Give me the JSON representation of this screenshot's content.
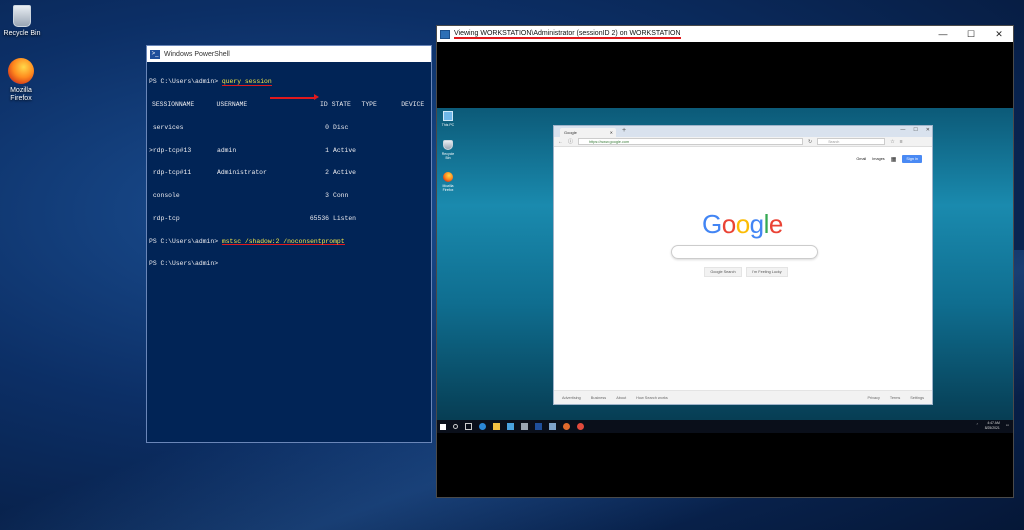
{
  "desktop": {
    "icons": [
      {
        "label": "Recycle Bin",
        "icon": "recycle-bin-icon"
      },
      {
        "label": "Mozilla Firefox",
        "icon": "firefox-icon"
      }
    ]
  },
  "powershell": {
    "title": "Windows PowerShell",
    "prompt": "PS C:\\Users\\admin>",
    "command1": "query session",
    "headers": [
      "SESSIONNAME",
      "USERNAME",
      "ID",
      "STATE",
      "TYPE",
      "DEVICE"
    ],
    "rows": [
      {
        "session": " services",
        "user": "",
        "id": "0",
        "state": "Disc"
      },
      {
        "session": ">rdp-tcp#13",
        "user": "admin",
        "id": "1",
        "state": "Active"
      },
      {
        "session": " rdp-tcp#11",
        "user": "Administrator",
        "id": "2",
        "state": "Active"
      },
      {
        "session": " console",
        "user": "",
        "id": "3",
        "state": "Conn"
      },
      {
        "session": " rdp-tcp",
        "user": "",
        "id": "65536",
        "state": "Listen"
      }
    ],
    "command2": "mstsc /shadow:2 /noconsentprompt"
  },
  "shadow_window": {
    "title": "Viewing WORKSTATION\\Administrator (sessionID 2) on WORKSTATION",
    "controls": {
      "minimize": "—",
      "maximize": "☐",
      "close": "✕"
    },
    "remote_desktop": {
      "icons": [
        "This PC",
        "Recycle Bin",
        "Mozilla Firefox"
      ],
      "browser": {
        "tab_title": "Google",
        "url": "https://www.google.com",
        "search_placeholder": "Search",
        "top_links": [
          "Gmail",
          "Images"
        ],
        "sign_in": "Sign in",
        "logo": [
          "G",
          "o",
          "o",
          "g",
          "l",
          "e"
        ],
        "buttons": [
          "Google Search",
          "I'm Feeling Lucky"
        ],
        "footer_left": [
          "Advertising",
          "Business",
          "About",
          "How Search works"
        ],
        "footer_right": [
          "Privacy",
          "Terms",
          "Settings"
        ]
      },
      "clock": {
        "time": "4:47 AM",
        "date": "8/25/2021"
      }
    }
  },
  "colors": {
    "annotation": "#e0191d",
    "ps_bg": "#012456",
    "ps_cmd": "#f5e84a"
  }
}
